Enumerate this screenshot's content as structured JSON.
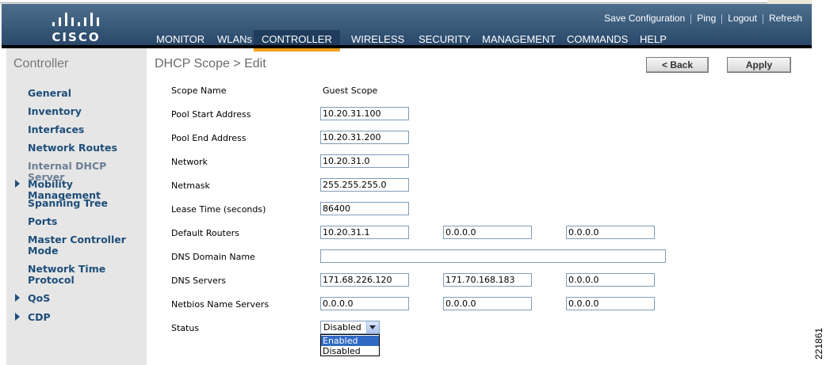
{
  "header": {
    "logo_text": "CISCO",
    "util_links": [
      "Save Configuration",
      "Ping",
      "Logout",
      "Refresh"
    ],
    "nav": [
      "MONITOR",
      "WLANs",
      "CONTROLLER",
      "WIRELESS",
      "SECURITY",
      "MANAGEMENT",
      "COMMANDS",
      "HELP"
    ],
    "active_nav": "CONTROLLER",
    "accent_color": "#f0a020"
  },
  "sidebar": {
    "title": "Controller",
    "items": [
      {
        "label": "General",
        "expandable": false
      },
      {
        "label": "Inventory",
        "expandable": false
      },
      {
        "label": "Interfaces",
        "expandable": false
      },
      {
        "label": "Network Routes",
        "expandable": false
      },
      {
        "label": "Internal DHCP Server",
        "expandable": false,
        "current": true
      },
      {
        "label": "Mobility Management",
        "expandable": true
      },
      {
        "label": "Spanning Tree",
        "expandable": false
      },
      {
        "label": "Ports",
        "expandable": false
      },
      {
        "label": "Master Controller Mode",
        "expandable": false
      },
      {
        "label": "Network Time Protocol",
        "expandable": false
      },
      {
        "label": "QoS",
        "expandable": true
      },
      {
        "label": "CDP",
        "expandable": true
      }
    ]
  },
  "page": {
    "title": "DHCP Scope > Edit",
    "back_label": "< Back",
    "apply_label": "Apply"
  },
  "form": {
    "scope_name": {
      "label": "Scope Name",
      "value": "Guest Scope"
    },
    "pool_start": {
      "label": "Pool Start Address",
      "value": "10.20.31.100"
    },
    "pool_end": {
      "label": "Pool End Address",
      "value": "10.20.31.200"
    },
    "network": {
      "label": "Network",
      "value": "10.20.31.0"
    },
    "netmask": {
      "label": "Netmask",
      "value": "255.255.255.0"
    },
    "lease_time": {
      "label": "Lease Time (seconds)",
      "value": "86400"
    },
    "default_routers": {
      "label": "Default Routers",
      "values": [
        "10.20.31.1",
        "0.0.0.0",
        "0.0.0.0"
      ]
    },
    "dns_domain": {
      "label": "DNS Domain Name",
      "value": ""
    },
    "dns_servers": {
      "label": "DNS Servers",
      "values": [
        "171.68.226.120",
        "171.70.168.183",
        "0.0.0.0"
      ]
    },
    "netbios": {
      "label": "Netbios Name Servers",
      "values": [
        "0.0.0.0",
        "0.0.0.0",
        "0.0.0.0"
      ]
    },
    "status": {
      "label": "Status",
      "selected": "Disabled",
      "options": [
        "Enabled",
        "Disabled"
      ],
      "highlighted": "Enabled"
    }
  },
  "figure_number": "221861"
}
